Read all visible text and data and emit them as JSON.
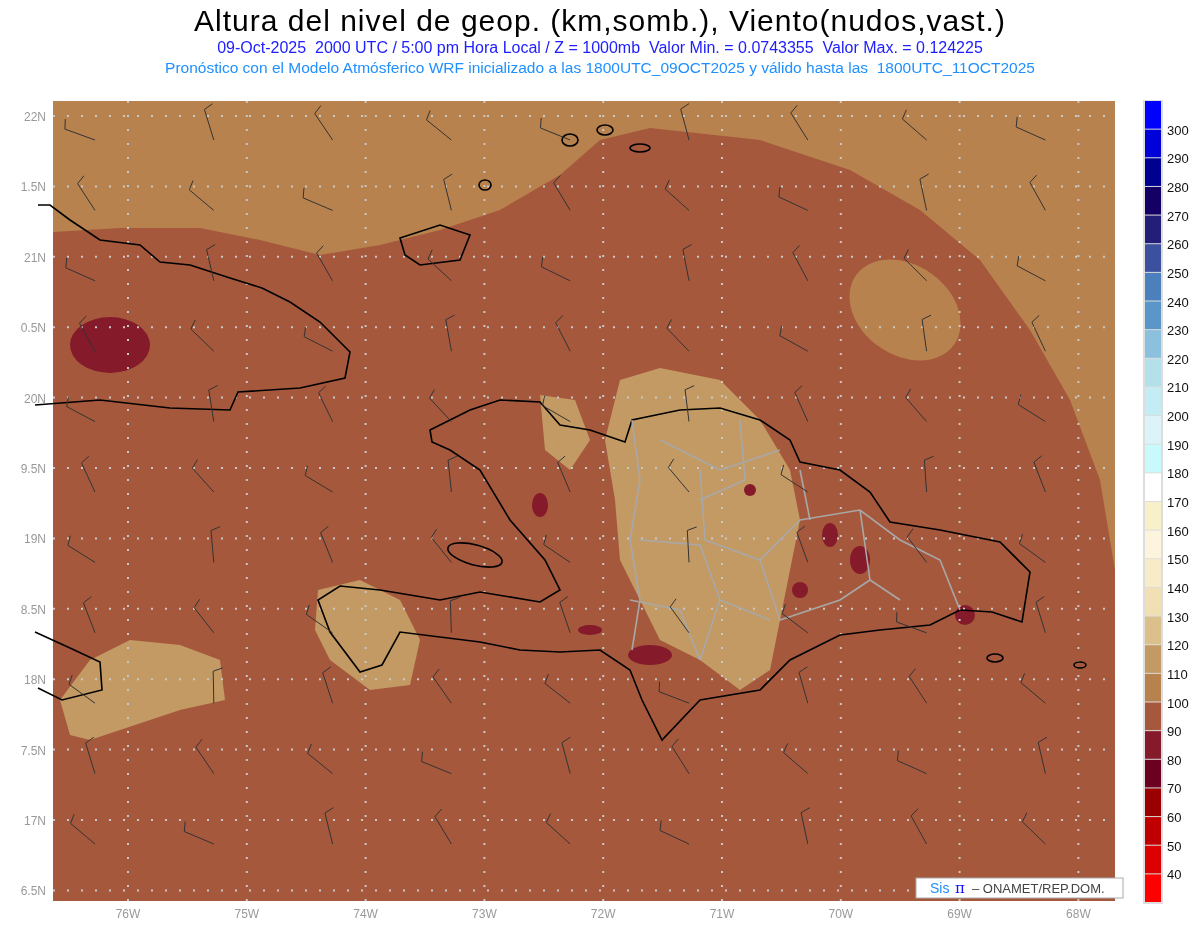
{
  "title": "Altura del nivel de geop. (km,somb.), Viento(nudos,vast.)",
  "subtitle": "09-Oct-2025  2000 UTC / 5:00 pm Hora Local / Z = 1000mb  Valor Min. = 0.0743355  Valor Max. = 0.124225",
  "model_line": "Pronóstico con el Modelo Atmósferico WRF inicializado a las 1800UTC_09OCT2025 y válido hasta las  1800UTC_11OCT2025",
  "map": {
    "lat_labels": [
      "22N",
      "1.5N",
      "21N",
      "0.5N",
      "20N",
      "9.5N",
      "19N",
      "8.5N",
      "18N",
      "7.5N",
      "17N",
      "6.5N"
    ],
    "lon_labels": [
      "76W",
      "75W",
      "74W",
      "73W",
      "72W",
      "71W",
      "70W",
      "69W",
      "68W"
    ]
  },
  "colorbar": {
    "bins": [
      {
        "color": "#0000ff",
        "label": "300"
      },
      {
        "color": "#0000d8",
        "label": "290"
      },
      {
        "color": "#000090",
        "label": "280"
      },
      {
        "color": "#140064",
        "label": "270"
      },
      {
        "color": "#231e78",
        "label": "260"
      },
      {
        "color": "#3c50a0",
        "label": "250"
      },
      {
        "color": "#4b80bc",
        "label": "240"
      },
      {
        "color": "#5a96c8",
        "label": "230"
      },
      {
        "color": "#8cc0dc",
        "label": "220"
      },
      {
        "color": "#b4e0ec",
        "label": "210"
      },
      {
        "color": "#c4ecf4",
        "label": "200"
      },
      {
        "color": "#dcf4f8",
        "label": "190"
      },
      {
        "color": "#c8fafc",
        "label": "180"
      },
      {
        "color": "#ffffff",
        "label": "170"
      },
      {
        "color": "#f8f0c8",
        "label": "160"
      },
      {
        "color": "#fcf4dc",
        "label": "150"
      },
      {
        "color": "#f8ecc8",
        "label": "140"
      },
      {
        "color": "#f0e0b4",
        "label": "130"
      },
      {
        "color": "#dcc08c",
        "label": "120"
      },
      {
        "color": "#c49a64",
        "label": "110"
      },
      {
        "color": "#b8824e",
        "label": "100"
      },
      {
        "color": "#a5583c",
        "label": "90"
      },
      {
        "color": "#851a2a",
        "label": "80"
      },
      {
        "color": "#6c0020",
        "label": "70"
      },
      {
        "color": "#9a0000",
        "label": "60"
      },
      {
        "color": "#c00000",
        "label": "50"
      },
      {
        "color": "#dc0000",
        "label": "40"
      },
      {
        "color": "#ff0000"
      }
    ]
  },
  "credit": {
    "logo": "Sis",
    "symbol": "π",
    "text": "– ONAMET/REP.DOM."
  }
}
